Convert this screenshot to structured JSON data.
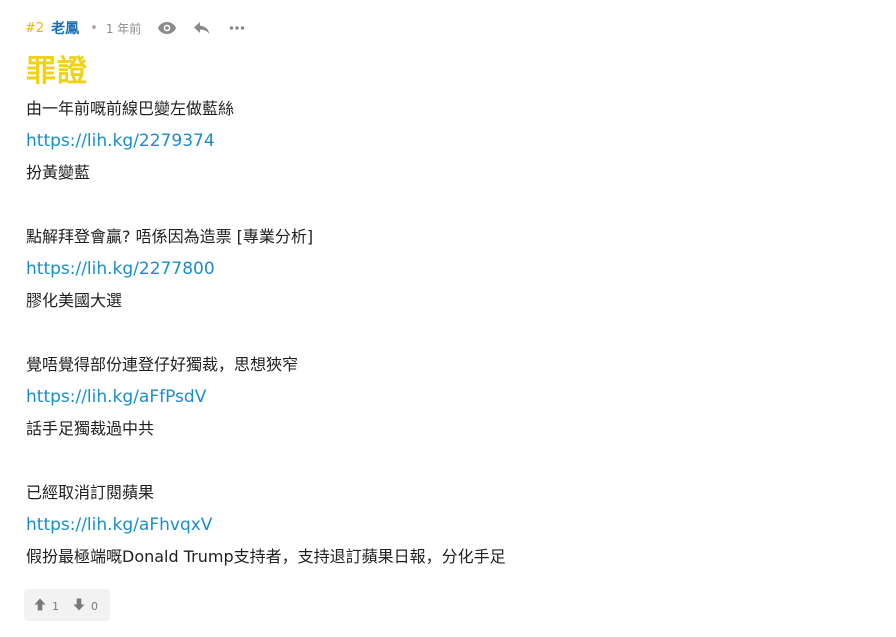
{
  "post": {
    "floor": "#2",
    "author": "老鳳",
    "separator": "•",
    "time": "1 年前",
    "icons": {
      "view": "eye-icon",
      "reply": "reply-icon",
      "more": "more-icon"
    },
    "title": "罪證",
    "lines": [
      {
        "type": "text",
        "text": "由一年前嘅前線巴變左做藍絲"
      },
      {
        "type": "link",
        "text": "https://lih.kg/2279374"
      },
      {
        "type": "text",
        "text": "扮黃變藍"
      },
      {
        "type": "blank",
        "text": ""
      },
      {
        "type": "text",
        "text": "點解拜登會贏? 唔係因為造票 [專業分析]"
      },
      {
        "type": "link",
        "text": "https://lih.kg/2277800"
      },
      {
        "type": "text",
        "text": "膠化美國大選"
      },
      {
        "type": "blank",
        "text": ""
      },
      {
        "type": "text",
        "text": "覺唔覺得部份連登仔好獨裁，思想狹窄"
      },
      {
        "type": "link",
        "text": "https://lih.kg/aFfPsdV"
      },
      {
        "type": "text",
        "text": "話手足獨裁過中共"
      },
      {
        "type": "blank",
        "text": ""
      },
      {
        "type": "text",
        "text": "已經取消訂閱蘋果"
      },
      {
        "type": "link",
        "text": "https://lih.kg/aFhvqxV"
      },
      {
        "type": "text",
        "text": "假扮最極端嘅Donald Trump支持者，支持退訂蘋果日報，分化手足"
      }
    ],
    "votes": {
      "up": "1",
      "down": "0"
    },
    "colors": {
      "floor": "#e6b800",
      "author": "#1c6fb0",
      "title": "#f0d21b",
      "link": "#1c8dc7"
    }
  }
}
